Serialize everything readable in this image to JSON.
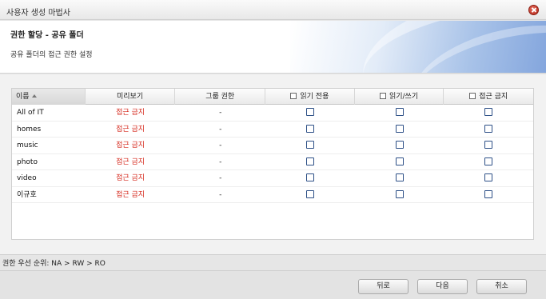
{
  "window": {
    "title": "사용자 생성 마법사"
  },
  "header": {
    "title": "권한 할당 - 공유 폴더",
    "subtitle": "공유 폴더의 접근 권한 설정"
  },
  "table": {
    "columns": {
      "name": "이름",
      "preview": "미리보기",
      "group_perm": "그룹 권한",
      "read_only": "읽기 전용",
      "read_write": "읽기/쓰기",
      "no_access": "접근 금지"
    },
    "rows": [
      {
        "name": "All of IT",
        "preview": "접근 금지",
        "group_perm": "-",
        "read_only": false,
        "read_write": false,
        "no_access": false
      },
      {
        "name": "homes",
        "preview": "접근 금지",
        "group_perm": "-",
        "read_only": false,
        "read_write": false,
        "no_access": false
      },
      {
        "name": "music",
        "preview": "접근 금지",
        "group_perm": "-",
        "read_only": false,
        "read_write": false,
        "no_access": false
      },
      {
        "name": "photo",
        "preview": "접근 금지",
        "group_perm": "-",
        "read_only": false,
        "read_write": false,
        "no_access": false
      },
      {
        "name": "video",
        "preview": "접근 금지",
        "group_perm": "-",
        "read_only": false,
        "read_write": false,
        "no_access": false
      },
      {
        "name": "이규호",
        "preview": "접근 금지",
        "group_perm": "-",
        "read_only": false,
        "read_write": false,
        "no_access": false
      }
    ]
  },
  "footer": {
    "priority": "권한 우선 순위: NA > RW > RO"
  },
  "buttons": {
    "back": "뒤로",
    "next": "다음",
    "cancel": "취소"
  },
  "colors": {
    "denied": "#d62b1f",
    "checkbox_border": "#2c4f86"
  }
}
